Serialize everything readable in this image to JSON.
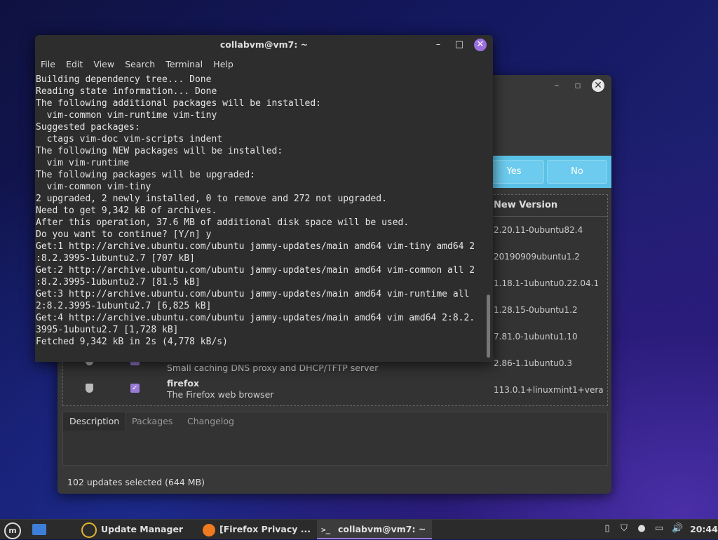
{
  "update_manager": {
    "banner": {
      "yes_label": "Yes",
      "no_label": "No"
    },
    "list": {
      "column_new_version": "New Version",
      "versions": [
        "2.20.11-0ubuntu82.4",
        "20190909ubuntu1.2",
        "1.18.1-1ubuntu0.22.04.1",
        "1.28.15-0ubuntu1.2",
        "7.81.0-1ubuntu1.10",
        "2.86-1.1ubuntu0.3",
        "113.0.1+linuxmint1+vera"
      ],
      "rows": [
        {
          "name": "",
          "desc": "Small caching DNS proxy and DHCP/TFTP server"
        },
        {
          "name": "firefox",
          "desc": "The Firefox web browser"
        }
      ]
    },
    "tabs": [
      "Description",
      "Packages",
      "Changelog"
    ],
    "status": "102 updates selected (644 MB)"
  },
  "terminal": {
    "title": "collabvm@vm7: ~",
    "menu": [
      "File",
      "Edit",
      "View",
      "Search",
      "Terminal",
      "Help"
    ],
    "output": "Building dependency tree... Done\nReading state information... Done\nThe following additional packages will be installed:\n  vim-common vim-runtime vim-tiny\nSuggested packages:\n  ctags vim-doc vim-scripts indent\nThe following NEW packages will be installed:\n  vim vim-runtime\nThe following packages will be upgraded:\n  vim-common vim-tiny\n2 upgraded, 2 newly installed, 0 to remove and 272 not upgraded.\nNeed to get 9,342 kB of archives.\nAfter this operation, 37.6 MB of additional disk space will be used.\nDo you want to continue? [Y/n] y\nGet:1 http://archive.ubuntu.com/ubuntu jammy-updates/main amd64 vim-tiny amd64 2\n:8.2.3995-1ubuntu2.7 [707 kB]\nGet:2 http://archive.ubuntu.com/ubuntu jammy-updates/main amd64 vim-common all 2\n:8.2.3995-1ubuntu2.7 [81.5 kB]\nGet:3 http://archive.ubuntu.com/ubuntu jammy-updates/main amd64 vim-runtime all\n2:8.2.3995-1ubuntu2.7 [6,825 kB]\nGet:4 http://archive.ubuntu.com/ubuntu jammy-updates/main amd64 vim amd64 2:8.2.\n3995-1ubuntu2.7 [1,728 kB]\nFetched 9,342 kB in 2s (4,778 kB/s)"
  },
  "taskbar": {
    "items": [
      {
        "label": "Update Manager",
        "icon": "update-manager-icon"
      },
      {
        "label": "[Firefox Privacy ...",
        "icon": "firefox-icon"
      },
      {
        "label": "collabvm@vm7: ~",
        "icon": "terminal-icon"
      }
    ],
    "clock": "20:44"
  }
}
